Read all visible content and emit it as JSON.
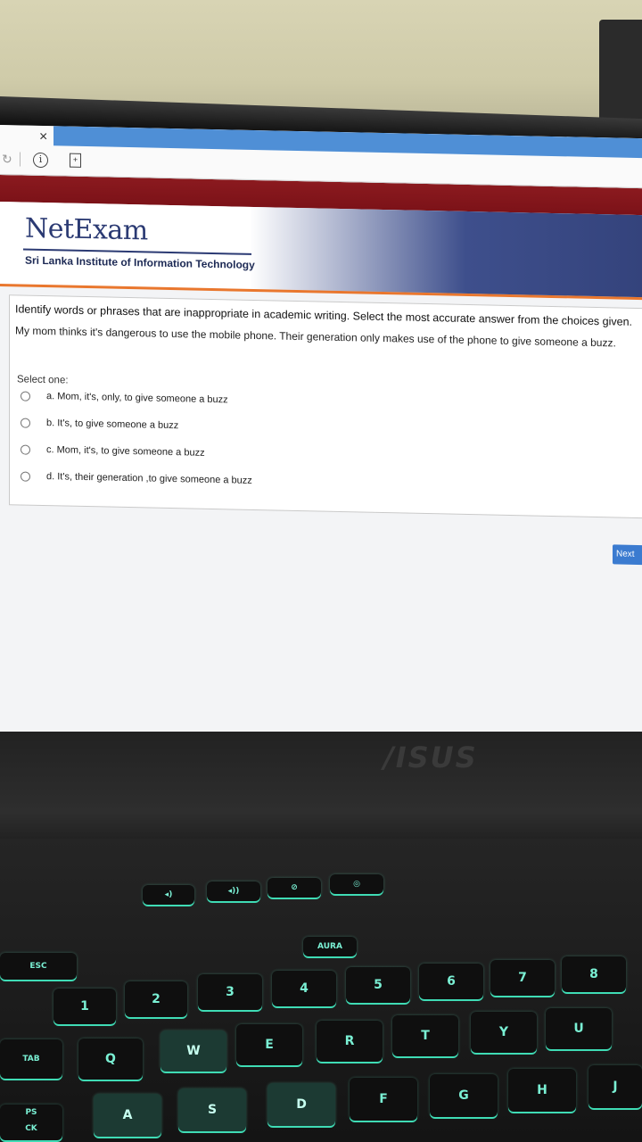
{
  "browser": {
    "close_glyph": "×",
    "reload_glyph": "↻",
    "info_glyph": "i",
    "ext_glyph": "+"
  },
  "header": {
    "logo": "NetExam",
    "institute": "Sri Lanka Institute of Information Technology"
  },
  "question": {
    "instruction": "Identify words or phrases that are inappropriate in academic writing. Select the most accurate answer from the choices given.",
    "sentence": "My mom thinks it's dangerous to use the mobile phone. Their generation only makes use of the phone to give someone a buzz.",
    "select_label": "Select one:",
    "options": [
      "a. Mom, it's, only, to give someone a buzz",
      "b. It's, to give someone a buzz",
      "c. Mom, it's, to give someone a buzz",
      "d. It's, their generation ,to give someone a buzz"
    ]
  },
  "next_label": "Next",
  "laptop": {
    "brand": "/ISUS",
    "keys": {
      "esc": "ESC",
      "tab": "TAB",
      "caps": "PS\nCK",
      "k1": "1",
      "k2": "2",
      "k3": "3",
      "k4": "4",
      "k5": "5",
      "k6": "6",
      "k7": "7",
      "k8": "8",
      "q": "Q",
      "w": "W",
      "e": "E",
      "r": "R",
      "t": "T",
      "y": "Y",
      "u": "U",
      "a": "A",
      "s": "S",
      "d": "D",
      "f": "F",
      "g": "G",
      "h": "H",
      "j": "J",
      "aura": "AURA"
    }
  }
}
